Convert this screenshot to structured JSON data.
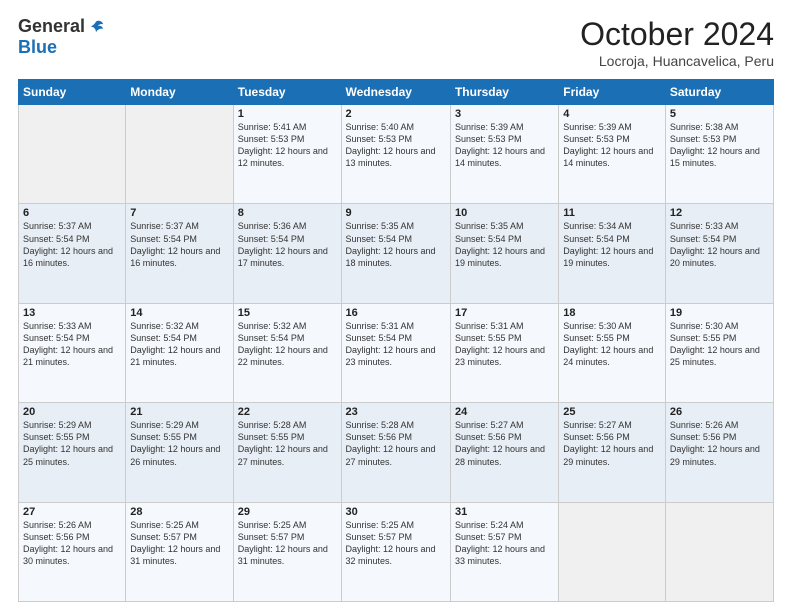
{
  "header": {
    "logo_general": "General",
    "logo_blue": "Blue",
    "title": "October 2024",
    "location": "Locroja, Huancavelica, Peru"
  },
  "days_of_week": [
    "Sunday",
    "Monday",
    "Tuesday",
    "Wednesday",
    "Thursday",
    "Friday",
    "Saturday"
  ],
  "weeks": [
    [
      {
        "day": "",
        "sunrise": "",
        "sunset": "",
        "daylight": ""
      },
      {
        "day": "",
        "sunrise": "",
        "sunset": "",
        "daylight": ""
      },
      {
        "day": "1",
        "sunrise": "Sunrise: 5:41 AM",
        "sunset": "Sunset: 5:53 PM",
        "daylight": "Daylight: 12 hours and 12 minutes."
      },
      {
        "day": "2",
        "sunrise": "Sunrise: 5:40 AM",
        "sunset": "Sunset: 5:53 PM",
        "daylight": "Daylight: 12 hours and 13 minutes."
      },
      {
        "day": "3",
        "sunrise": "Sunrise: 5:39 AM",
        "sunset": "Sunset: 5:53 PM",
        "daylight": "Daylight: 12 hours and 14 minutes."
      },
      {
        "day": "4",
        "sunrise": "Sunrise: 5:39 AM",
        "sunset": "Sunset: 5:53 PM",
        "daylight": "Daylight: 12 hours and 14 minutes."
      },
      {
        "day": "5",
        "sunrise": "Sunrise: 5:38 AM",
        "sunset": "Sunset: 5:53 PM",
        "daylight": "Daylight: 12 hours and 15 minutes."
      }
    ],
    [
      {
        "day": "6",
        "sunrise": "Sunrise: 5:37 AM",
        "sunset": "Sunset: 5:54 PM",
        "daylight": "Daylight: 12 hours and 16 minutes."
      },
      {
        "day": "7",
        "sunrise": "Sunrise: 5:37 AM",
        "sunset": "Sunset: 5:54 PM",
        "daylight": "Daylight: 12 hours and 16 minutes."
      },
      {
        "day": "8",
        "sunrise": "Sunrise: 5:36 AM",
        "sunset": "Sunset: 5:54 PM",
        "daylight": "Daylight: 12 hours and 17 minutes."
      },
      {
        "day": "9",
        "sunrise": "Sunrise: 5:35 AM",
        "sunset": "Sunset: 5:54 PM",
        "daylight": "Daylight: 12 hours and 18 minutes."
      },
      {
        "day": "10",
        "sunrise": "Sunrise: 5:35 AM",
        "sunset": "Sunset: 5:54 PM",
        "daylight": "Daylight: 12 hours and 19 minutes."
      },
      {
        "day": "11",
        "sunrise": "Sunrise: 5:34 AM",
        "sunset": "Sunset: 5:54 PM",
        "daylight": "Daylight: 12 hours and 19 minutes."
      },
      {
        "day": "12",
        "sunrise": "Sunrise: 5:33 AM",
        "sunset": "Sunset: 5:54 PM",
        "daylight": "Daylight: 12 hours and 20 minutes."
      }
    ],
    [
      {
        "day": "13",
        "sunrise": "Sunrise: 5:33 AM",
        "sunset": "Sunset: 5:54 PM",
        "daylight": "Daylight: 12 hours and 21 minutes."
      },
      {
        "day": "14",
        "sunrise": "Sunrise: 5:32 AM",
        "sunset": "Sunset: 5:54 PM",
        "daylight": "Daylight: 12 hours and 21 minutes."
      },
      {
        "day": "15",
        "sunrise": "Sunrise: 5:32 AM",
        "sunset": "Sunset: 5:54 PM",
        "daylight": "Daylight: 12 hours and 22 minutes."
      },
      {
        "day": "16",
        "sunrise": "Sunrise: 5:31 AM",
        "sunset": "Sunset: 5:54 PM",
        "daylight": "Daylight: 12 hours and 23 minutes."
      },
      {
        "day": "17",
        "sunrise": "Sunrise: 5:31 AM",
        "sunset": "Sunset: 5:55 PM",
        "daylight": "Daylight: 12 hours and 23 minutes."
      },
      {
        "day": "18",
        "sunrise": "Sunrise: 5:30 AM",
        "sunset": "Sunset: 5:55 PM",
        "daylight": "Daylight: 12 hours and 24 minutes."
      },
      {
        "day": "19",
        "sunrise": "Sunrise: 5:30 AM",
        "sunset": "Sunset: 5:55 PM",
        "daylight": "Daylight: 12 hours and 25 minutes."
      }
    ],
    [
      {
        "day": "20",
        "sunrise": "Sunrise: 5:29 AM",
        "sunset": "Sunset: 5:55 PM",
        "daylight": "Daylight: 12 hours and 25 minutes."
      },
      {
        "day": "21",
        "sunrise": "Sunrise: 5:29 AM",
        "sunset": "Sunset: 5:55 PM",
        "daylight": "Daylight: 12 hours and 26 minutes."
      },
      {
        "day": "22",
        "sunrise": "Sunrise: 5:28 AM",
        "sunset": "Sunset: 5:55 PM",
        "daylight": "Daylight: 12 hours and 27 minutes."
      },
      {
        "day": "23",
        "sunrise": "Sunrise: 5:28 AM",
        "sunset": "Sunset: 5:56 PM",
        "daylight": "Daylight: 12 hours and 27 minutes."
      },
      {
        "day": "24",
        "sunrise": "Sunrise: 5:27 AM",
        "sunset": "Sunset: 5:56 PM",
        "daylight": "Daylight: 12 hours and 28 minutes."
      },
      {
        "day": "25",
        "sunrise": "Sunrise: 5:27 AM",
        "sunset": "Sunset: 5:56 PM",
        "daylight": "Daylight: 12 hours and 29 minutes."
      },
      {
        "day": "26",
        "sunrise": "Sunrise: 5:26 AM",
        "sunset": "Sunset: 5:56 PM",
        "daylight": "Daylight: 12 hours and 29 minutes."
      }
    ],
    [
      {
        "day": "27",
        "sunrise": "Sunrise: 5:26 AM",
        "sunset": "Sunset: 5:56 PM",
        "daylight": "Daylight: 12 hours and 30 minutes."
      },
      {
        "day": "28",
        "sunrise": "Sunrise: 5:25 AM",
        "sunset": "Sunset: 5:57 PM",
        "daylight": "Daylight: 12 hours and 31 minutes."
      },
      {
        "day": "29",
        "sunrise": "Sunrise: 5:25 AM",
        "sunset": "Sunset: 5:57 PM",
        "daylight": "Daylight: 12 hours and 31 minutes."
      },
      {
        "day": "30",
        "sunrise": "Sunrise: 5:25 AM",
        "sunset": "Sunset: 5:57 PM",
        "daylight": "Daylight: 12 hours and 32 minutes."
      },
      {
        "day": "31",
        "sunrise": "Sunrise: 5:24 AM",
        "sunset": "Sunset: 5:57 PM",
        "daylight": "Daylight: 12 hours and 33 minutes."
      },
      {
        "day": "",
        "sunrise": "",
        "sunset": "",
        "daylight": ""
      },
      {
        "day": "",
        "sunrise": "",
        "sunset": "",
        "daylight": ""
      }
    ]
  ]
}
